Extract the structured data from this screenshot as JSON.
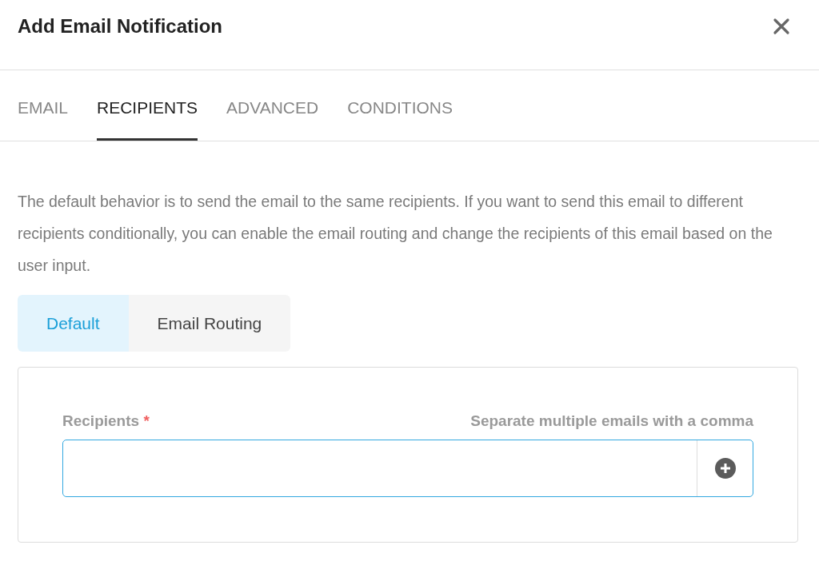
{
  "dialog": {
    "title": "Add Email Notification"
  },
  "tabs": [
    {
      "label": "EMAIL",
      "selected": false
    },
    {
      "label": "RECIPIENTS",
      "selected": true
    },
    {
      "label": "ADVANCED",
      "selected": false
    },
    {
      "label": "CONDITIONS",
      "selected": false
    }
  ],
  "description": "The default behavior is to send the email to the same recipients. If you want to send this email to different recipients conditionally, you can enable the email routing and change the recipients of this email based on the user input.",
  "mode_toggle": [
    {
      "label": "Default",
      "selected": true
    },
    {
      "label": "Email Routing",
      "selected": false
    }
  ],
  "recipients_field": {
    "label": "Recipients",
    "required_mark": "*",
    "hint": "Separate multiple emails with a comma",
    "focused": true
  }
}
